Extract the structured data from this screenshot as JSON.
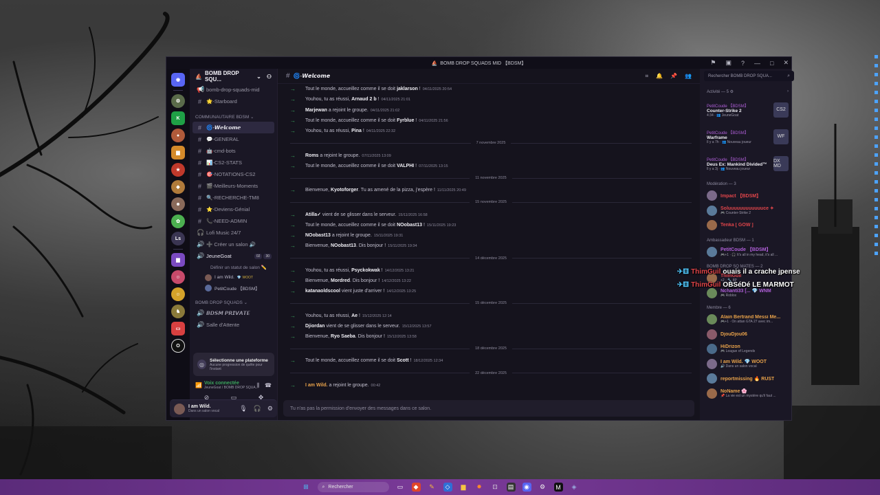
{
  "window": {
    "title": "BOMB DROP SQUADS MID 【BDSM】"
  },
  "server": {
    "name": "BOMB DROP SQU...",
    "rail_labels": [
      "Ls"
    ]
  },
  "channels": {
    "top": [
      {
        "icon": "📢",
        "label": "bomb-drop-squads-mid"
      },
      {
        "icon": "#",
        "label": "🌟-Starboard"
      }
    ],
    "category1": "COMMUNAUTAIRE BDSM",
    "list1": [
      {
        "icon": "#",
        "label": "🌀-𝙒𝙚𝙡𝙘𝙤𝙢𝙚",
        "active": true
      },
      {
        "icon": "#",
        "label": "💬-GENERAL"
      },
      {
        "icon": "#",
        "label": "🤖-cmd-bots"
      },
      {
        "icon": "#",
        "label": "📊-CS2-STATS"
      },
      {
        "icon": "#",
        "label": "🎯-NOTATIONS-CS2"
      },
      {
        "icon": "#",
        "label": "🎬-Meilleurs-Moments"
      },
      {
        "icon": "#",
        "label": "🔍-RECHERCHE-TM8"
      },
      {
        "icon": "#",
        "label": "⭐-Deviens-Génial"
      },
      {
        "icon": "#",
        "label": "📞-NEED-ADMIN"
      },
      {
        "icon": "🎧",
        "label": "Lofi Music 24/7"
      },
      {
        "icon": "🔊",
        "label": "➕ Créer un salon 🔊"
      },
      {
        "icon": "🔊",
        "label": "JeuneGoat"
      }
    ],
    "voice_status": "Définir un statut de salon ✏️",
    "voice_counts": [
      "02",
      "30"
    ],
    "voice_users": [
      "I am Wild.",
      "PetitCoude 【BDSM】"
    ],
    "voice_user_badge": "💎 WOOT",
    "category2": "BOMB DROP SQUADS",
    "list2": [
      {
        "icon": "🔊",
        "label": "𝘽𝘿𝙎𝙈 𝙋𝙍𝙄𝙑𝘼𝙏𝙀"
      },
      {
        "icon": "🔊",
        "label": "Salle d'Attente"
      }
    ]
  },
  "quest": {
    "title": "Sélectionne une plateforme",
    "subtitle": "Aucune progression de quête pour l'instant"
  },
  "voice_panel": {
    "status": "Voix connectée",
    "location": "JeuneGoat / BOMB DROP SQUA..."
  },
  "user_panel": {
    "name": "I am Wild.",
    "status": "Dans un salon vocal"
  },
  "chat": {
    "channel": "🌀-𝙒𝙚𝙡𝙘𝙤𝙢𝙚",
    "placeholder": "Tu n'as pas la permission d'envoyer des messages dans ce salon.",
    "blocks": [
      {
        "type": "msg",
        "pre": "Tout le monde, accueillez comme il se doit ",
        "name": "jaklarson",
        "post": " !",
        "ts": "04/11/2025 20:54"
      },
      {
        "type": "msg",
        "pre": "Youhou, tu as réussi, ",
        "name": "Arnaud 2 b",
        "post": " !",
        "ts": "04/11/2025 21:01"
      },
      {
        "type": "msg",
        "pre": "",
        "name": "Marjewan",
        "post": " a rejoint le groupe.",
        "ts": "04/11/2025 21:02"
      },
      {
        "type": "msg",
        "pre": "Tout le monde, accueillez comme il se doit ",
        "name": "Fyrblue",
        "post": " !",
        "ts": "04/11/2025 21:56"
      },
      {
        "type": "msg",
        "pre": "Youhou, tu as réussi, ",
        "name": "Pina",
        "post": " !",
        "ts": "04/11/2025 22:32"
      },
      {
        "type": "div",
        "label": "7 novembre 2025"
      },
      {
        "type": "msg",
        "pre": "",
        "name": "Roms",
        "post": " a rejoint le groupe.",
        "ts": "07/11/2025 13:09"
      },
      {
        "type": "msg",
        "pre": "Tout le monde, accueillez comme il se doit ",
        "name": "VALPHI",
        "post": " !",
        "ts": "07/11/2025 13:15"
      },
      {
        "type": "div",
        "label": "11 novembre 2025"
      },
      {
        "type": "msg",
        "pre": "Bienvenue, ",
        "name": "Kyotoforger",
        "post": ". Tu as amené de la pizza, j'espère !",
        "ts": "11/11/2025 20:49"
      },
      {
        "type": "div",
        "label": "15 novembre 2025"
      },
      {
        "type": "msg",
        "pre": "",
        "name": "Atilla✓",
        "post": " vient de se glisser dans le serveur.",
        "ts": "15/11/2025 16:58"
      },
      {
        "type": "msg",
        "pre": "Tout le monde, accueillez comme il se doit ",
        "name": "NOobast13",
        "post": " !",
        "ts": "15/11/2025 19:23"
      },
      {
        "type": "msg",
        "pre": "",
        "name": "NOobast13",
        "post": " a rejoint le groupe.",
        "ts": "15/11/2025 19:31"
      },
      {
        "type": "msg",
        "pre": "Bienvenue, ",
        "name": "NOobast13",
        "post": ". Dis bonjour !",
        "ts": "15/11/2025 19:34"
      },
      {
        "type": "div",
        "label": "14 décembre 2025"
      },
      {
        "type": "msg",
        "pre": "Youhou, tu as réussi, ",
        "name": "Psyckokwak",
        "post": " !",
        "ts": "14/12/2025 13:21"
      },
      {
        "type": "msg",
        "pre": "Bienvenue, ",
        "name": "Mordred",
        "post": ". Dis bonjour !",
        "ts": "14/12/2025 13:22"
      },
      {
        "type": "msg",
        "pre": "",
        "name": "katanaoldscool",
        "post": " vient juste d'arriver !",
        "ts": "14/12/2025 13:25"
      },
      {
        "type": "div",
        "label": "15 décembre 2025"
      },
      {
        "type": "msg",
        "pre": "Youhou, tu as réussi, ",
        "name": "Ae",
        "post": " !",
        "ts": "15/12/2025 12:14"
      },
      {
        "type": "msg",
        "pre": "",
        "name": "Djiordan",
        "post": " vient de se glisser dans le serveur.",
        "ts": "15/12/2025 13:57"
      },
      {
        "type": "msg",
        "pre": "Bienvenue, ",
        "name": "Ryo Saeba",
        "post": ". Dis bonjour !",
        "ts": "15/12/2025 13:58"
      },
      {
        "type": "div",
        "label": "18 décembre 2025"
      },
      {
        "type": "msg",
        "pre": "Tout le monde, accueillez comme il se doit ",
        "name": "Scott",
        "post": " !",
        "ts": "18/12/2025 12:34"
      },
      {
        "type": "div",
        "label": "22 décembre 2025"
      },
      {
        "type": "msg",
        "pre": "",
        "name": "I am Wild.",
        "post": " a rejoint le groupe.",
        "ts": "00:42",
        "color": "#e8a24a"
      }
    ]
  },
  "members": {
    "search_placeholder": "Rechercher BOMB DROP SQUA...",
    "activity_header": "Activité — 5 ⚙",
    "activities": [
      {
        "user": "PetitCoude 【BDSM】",
        "game": "Counter-Strike 2",
        "detail": "4:34 · 👥 JeuneGoat",
        "thumb": "CS2"
      },
      {
        "user": "PetitCoude 【BDSM】",
        "game": "Warframe",
        "detail": "Il y a 7h · 👥 Nouveau joueur",
        "thumb": "WF"
      },
      {
        "user": "PetitCoude 【BDSM】",
        "game": "Deus Ex: Mankind Divided™",
        "detail": "Il y a 3j · 👥 Nouveau joueur",
        "thumb": "DX MD"
      }
    ],
    "sections": [
      {
        "title": "Modération — 3",
        "users": [
          {
            "name": "Impact 【BDSM】",
            "sub": "",
            "color": "#e0454a"
          },
          {
            "name": "Soluuuuuuuuuuuuce ✦",
            "sub": "🎮 Counter-Strike 2",
            "color": "#e0454a"
          },
          {
            "name": "Tenka [ GOW ]",
            "sub": "",
            "color": "#e0454a"
          }
        ]
      },
      {
        "title": "Ambassadeur BDSM — 1",
        "users": [
          {
            "name": "PetitCoude 【BDSM】",
            "sub": "🎮+1 · 🎧 It's all in my head, it's all ...",
            "color": "#b05fd9"
          }
        ]
      },
      {
        "title": "BOMB DROP SQ MATES — 2",
        "users": [
          {
            "name": "ThimGuil",
            "sub": "+2 · 🔧 8P",
            "color": "#e0454a"
          },
          {
            "name": "Nchanti33 [... 💎 WNM",
            "sub": "🎮 Roblox",
            "color": "#b05fd9"
          }
        ]
      },
      {
        "title": "Membre — 6",
        "users": [
          {
            "name": "Alain Bertrand Messi Me...",
            "sub": "🎮+1 · On attan GTA 27 avec im...",
            "color": "#e8a24a"
          },
          {
            "name": "DjouDjou06",
            "sub": "",
            "color": "#e8a24a"
          },
          {
            "name": "HiDrizon",
            "sub": "🎮 League of Legends",
            "color": "#e8a24a"
          },
          {
            "name": "I am Wild. 💎 WOOT",
            "sub": "🔊 Dans un salon vocal",
            "color": "#e8a24a"
          },
          {
            "name": "reportmissing 🔥 RUST",
            "sub": "",
            "color": "#e8a24a"
          },
          {
            "name": "NoName 🌸",
            "sub": "📌 La vie est un mystère qu'il faut ...",
            "color": "#e8a24a"
          }
        ]
      }
    ]
  },
  "overlay": [
    {
      "name": "ThimGuil",
      "text": "ouais il a crache jpense"
    },
    {
      "name": "ThimGuil",
      "text": "OBSéDé LE MARMOT"
    }
  ],
  "taskbar": {
    "search_label": "Rechercher"
  }
}
